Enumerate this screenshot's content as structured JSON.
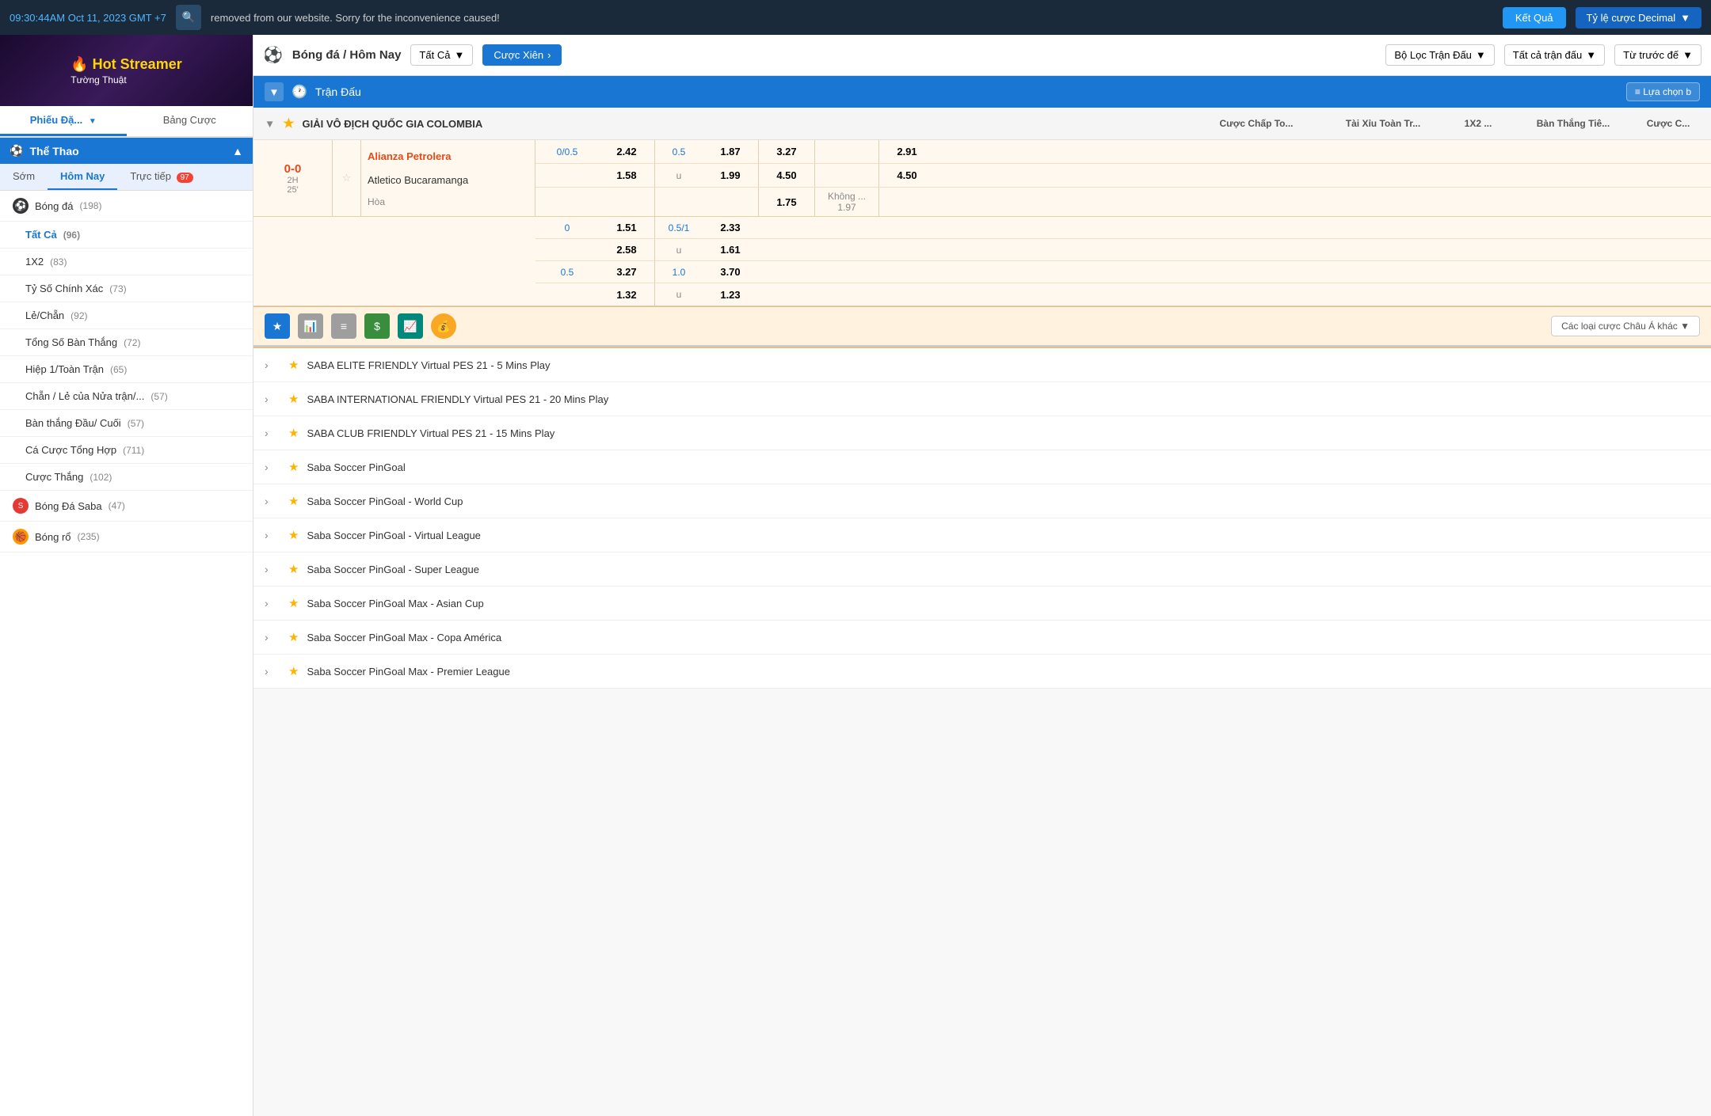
{
  "topbar": {
    "time": "09:30:44AM Oct 11, 2023 GMT +7",
    "notice": "removed from our website. Sorry for the inconvenience caused!",
    "btn_ket_qua": "Kết Quả",
    "btn_ty_le": "Tỷ lệ cược Decimal"
  },
  "sidebar": {
    "banner_line1": "Hot Streamer",
    "banner_line2": "Tường Thuật",
    "tab1": "Phiếu Đặ...",
    "tab2": "Bảng Cược",
    "section": "Thể Thao",
    "sub_tabs": [
      "Sớm",
      "Hôm Nay",
      "Trực tiếp"
    ],
    "live_badge": "97",
    "menu_items": [
      {
        "icon": "football",
        "label": "Bóng đá",
        "count": "(198)"
      },
      {
        "label": "Tất Cả",
        "count": "(96)",
        "active": true
      },
      {
        "label": "1X2",
        "count": "(83)"
      },
      {
        "label": "Tỷ Số Chính Xác",
        "count": "(73)"
      },
      {
        "label": "Lẻ/Chẵn",
        "count": "(92)"
      },
      {
        "label": "Tổng Số Bàn Thắng",
        "count": "(72)"
      },
      {
        "label": "Hiệp 1/Toàn Trận",
        "count": "(65)"
      },
      {
        "label": "Chẵn / Lẻ của Nửa trận/...",
        "count": "(57)"
      },
      {
        "label": "Bàn thắng Đầu/ Cuối",
        "count": "(57)"
      },
      {
        "label": "Cá Cược Tổng Hợp",
        "count": "(711)"
      },
      {
        "label": "Cược Thắng",
        "count": "(102)"
      },
      {
        "icon": "saba",
        "label": "Bóng Đá Saba",
        "count": "(47)"
      },
      {
        "icon": "basketball",
        "label": "Bóng rổ",
        "count": "(235)"
      }
    ]
  },
  "content_header": {
    "sport_icon": "⚽",
    "title": "Bóng đá / Hôm Nay",
    "tat_ca": "Tất Cả",
    "cuoc_xien": "Cược Xiên",
    "bo_loc": "Bộ Lọc Trận Đấu",
    "tat_ca_tran": "Tất cả trận đấu",
    "tu_truoc": "Từ trước đế"
  },
  "sub_header": {
    "title": "Trận Đấu",
    "lua_chon": "≡ Lựa chọn b"
  },
  "table_headers": {
    "cuoc_chap": "Cược Chấp To...",
    "tai_xiu": "Tài Xỉu Toàn Tr...",
    "x1x2": "1X2 ...",
    "ban_thang": "Bàn Thắng Tiê...",
    "cuoc_c": "Cược C..."
  },
  "league": {
    "name": "GIẢI VÔ ĐỊCH QUỐC GIA COLOMBIA",
    "team1": "Alianza Petrolera",
    "team2": "Atletico Bucaramanga",
    "draw": "Hòa",
    "score": "0-0",
    "time_label": "2H",
    "time_min": "25'",
    "odds_rows": [
      {
        "chap": "0/0.5",
        "chap_val": "2.42",
        "taixiu_chap": "0.5",
        "taixiu_val": "1.87",
        "x1x2": "3.27",
        "ban_thang": "",
        "cuoc_c": "2.91"
      },
      {
        "chap": "",
        "chap_val": "1.58",
        "taixiu_chap": "u",
        "taixiu_val": "1.99",
        "x1x2": "4.50",
        "ban_thang": "",
        "cuoc_c": "4.50"
      },
      {
        "chap": "",
        "chap_val": "",
        "taixiu_chap": "",
        "taixiu_val": "",
        "x1x2": "1.75",
        "ban_thang": "Không ...",
        "cuoc_c": "1.97"
      }
    ],
    "extra_rows": [
      {
        "h1": "0",
        "v1": "1.51",
        "h2": "0.5/1",
        "v2": "2.33",
        "v3": "",
        "v4": ""
      },
      {
        "h1": "",
        "v1": "2.58",
        "h2": "u",
        "v2": "1.61",
        "v3": "",
        "v4": ""
      },
      {
        "h1": "0.5",
        "v1": "3.27",
        "h2": "1.0",
        "v2": "3.70",
        "v3": "",
        "v4": ""
      },
      {
        "h1": "",
        "v1": "1.32",
        "h2": "u",
        "v2": "1.23",
        "v3": "",
        "v4": ""
      }
    ],
    "cac_loai": "Các loại cược Châu Á khác"
  },
  "action_icons": [
    {
      "label": "★",
      "type": "blue"
    },
    {
      "label": "📊",
      "type": "gray"
    },
    {
      "label": "≡",
      "type": "gray"
    },
    {
      "label": "$",
      "type": "green"
    },
    {
      "label": "📈",
      "type": "teal"
    },
    {
      "label": "💰",
      "type": "yellow"
    }
  ],
  "league_list": [
    "SABA ELITE FRIENDLY Virtual PES 21 - 5 Mins Play",
    "SABA INTERNATIONAL FRIENDLY Virtual PES 21 - 20 Mins Play",
    "SABA CLUB FRIENDLY Virtual PES 21 - 15 Mins Play",
    "Saba Soccer PinGoal",
    "Saba Soccer PinGoal - World Cup",
    "Saba Soccer PinGoal - Virtual League",
    "Saba Soccer PinGoal - Super League",
    "Saba Soccer PinGoal Max - Asian Cup",
    "Saba Soccer PinGoal Max - Copa América",
    "Saba Soccer PinGoal Max - Premier League"
  ],
  "colors": {
    "blue": "#1976d2",
    "orange": "#e64a19",
    "header_bg": "#1a2a3a"
  }
}
